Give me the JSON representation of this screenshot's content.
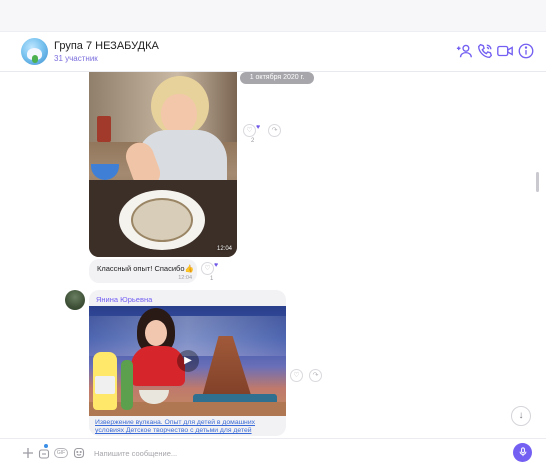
{
  "header": {
    "title": "Група 7 НЕЗАБУДКА",
    "participants": "31 участник",
    "icons": [
      "add-participant-icon",
      "phone-icon",
      "video-call-icon",
      "info-icon"
    ]
  },
  "chat": {
    "date_separator": "1 октября 2020 г.",
    "photo_message": {
      "time": "12:04",
      "reaction_count": "2"
    },
    "text_message": {
      "text": "Классный опыт! Спасибо👍",
      "time": "12:04",
      "reaction_count": "1"
    },
    "video_message": {
      "sender": "Янина Юрьевна",
      "link_text": "Извержение вулкана. Опыт для детей в домашних условиях Детское творчество с детьми для детей"
    }
  },
  "composer": {
    "placeholder": "Напишите сообщение...",
    "icons": [
      "plus-icon",
      "sticker-icon",
      "gif-icon",
      "emoji-icon",
      "microphone-icon"
    ],
    "gif_label": "GIF"
  },
  "colors": {
    "accent": "#7360f2",
    "link": "#3b6bd6",
    "bubble": "#f2f2f5",
    "date_pill": "#a6a6ab"
  }
}
